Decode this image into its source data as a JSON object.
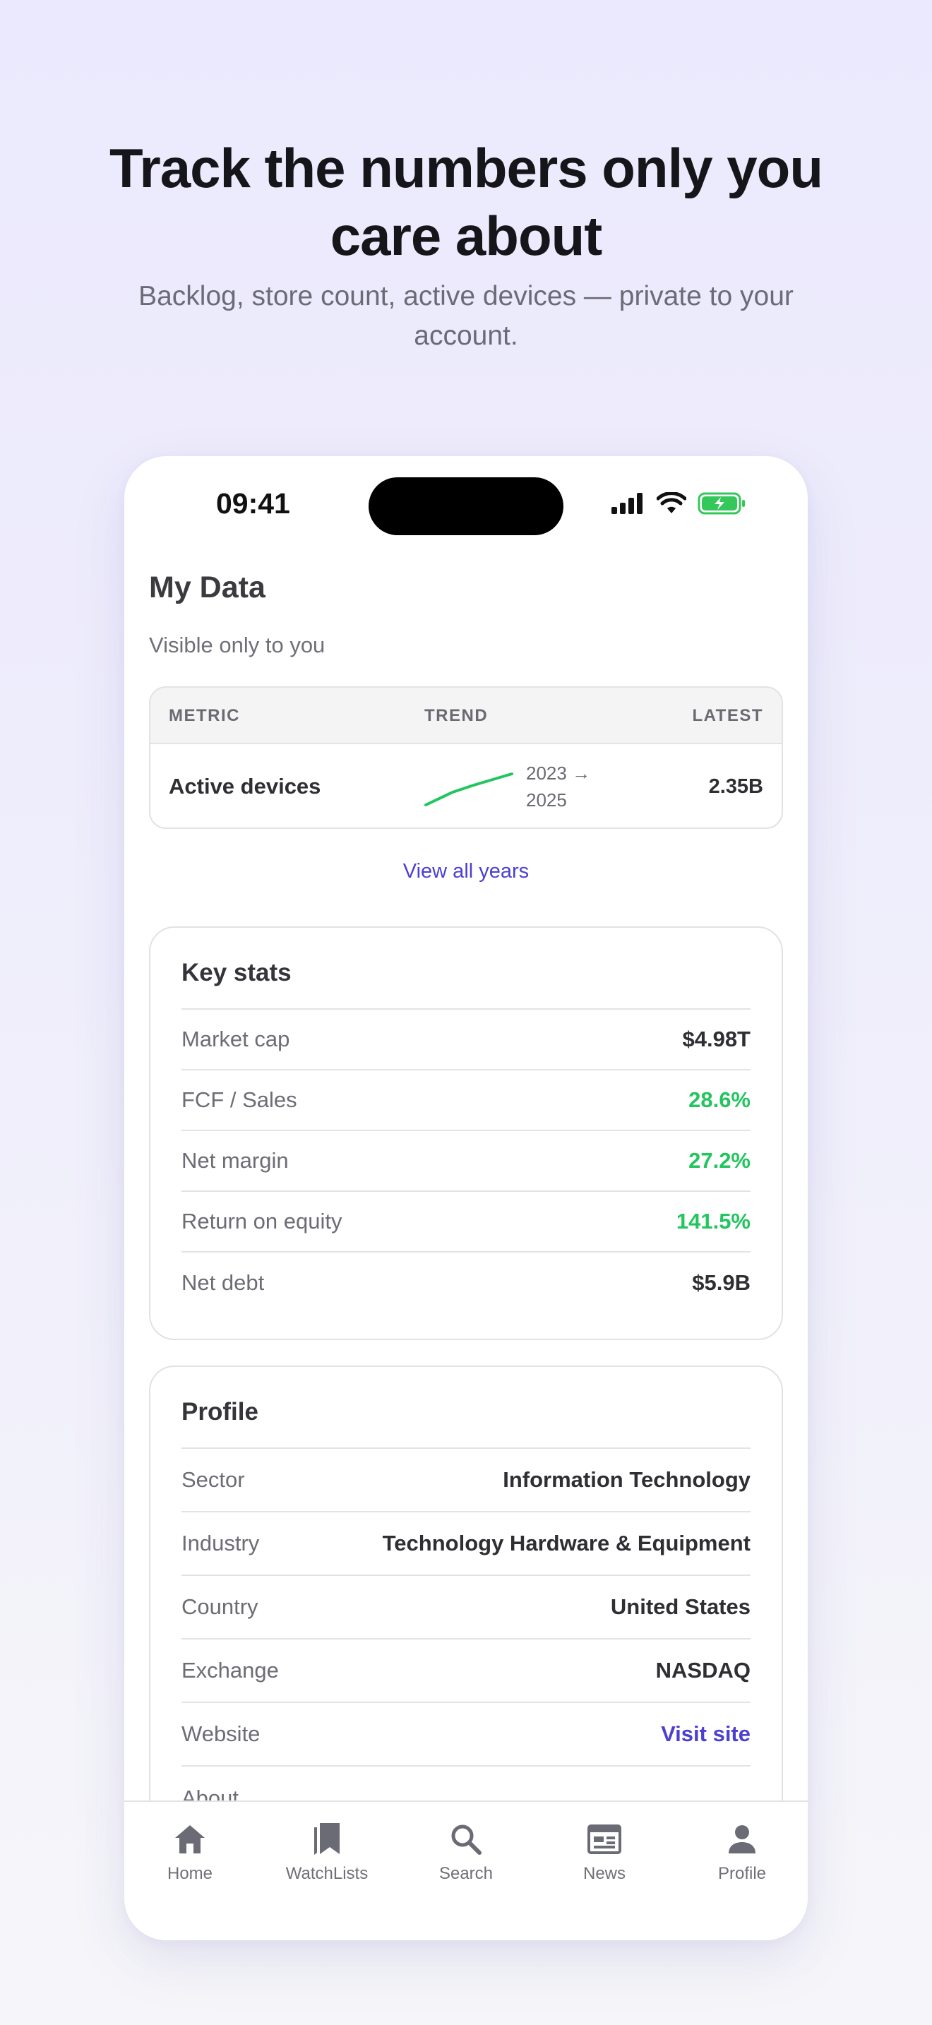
{
  "hero": {
    "title_line1": "Track the numbers only you",
    "title_line2": "care about",
    "subtitle_line1": "Backlog, store count, active devices — private to your",
    "subtitle_line2": "account."
  },
  "status_bar": {
    "time": "09:41"
  },
  "my_data": {
    "title": "My Data",
    "subtitle": "Visible only to you",
    "table": {
      "headers": {
        "metric": "METRIC",
        "trend": "TREND",
        "latest": "LATEST"
      },
      "rows": [
        {
          "metric": "Active devices",
          "range_line1": "2023 →",
          "range_line2": "2025",
          "latest": "2.35B"
        }
      ]
    },
    "view_all_label": "View all years"
  },
  "key_stats": {
    "title": "Key stats",
    "rows": [
      {
        "label": "Market cap",
        "value": "$4.98T",
        "tone": "neutral"
      },
      {
        "label": "FCF / Sales",
        "value": "28.6%",
        "tone": "positive"
      },
      {
        "label": "Net margin",
        "value": "27.2%",
        "tone": "positive"
      },
      {
        "label": "Return on equity",
        "value": "141.5%",
        "tone": "positive"
      },
      {
        "label": "Net debt",
        "value": "$5.9B",
        "tone": "neutral"
      }
    ]
  },
  "profile": {
    "title": "Profile",
    "rows": [
      {
        "label": "Sector",
        "value": "Information Technology"
      },
      {
        "label": "Industry",
        "value": "Technology Hardware & Equipment"
      },
      {
        "label": "Country",
        "value": "United States"
      },
      {
        "label": "Exchange",
        "value": "NASDAQ"
      },
      {
        "label": "Website",
        "value": "Visit site"
      },
      {
        "label": "About",
        "value": ""
      }
    ]
  },
  "tabbar": {
    "items": [
      {
        "label": "Home",
        "icon": "home-icon"
      },
      {
        "label": "WatchLists",
        "icon": "bookmark-icon"
      },
      {
        "label": "Search",
        "icon": "search-icon"
      },
      {
        "label": "News",
        "icon": "newspaper-icon"
      },
      {
        "label": "Profile",
        "icon": "person-icon"
      }
    ]
  },
  "colors": {
    "accent": "#4d3fd1",
    "positive": "#22c55e",
    "battery": "#34c759"
  }
}
